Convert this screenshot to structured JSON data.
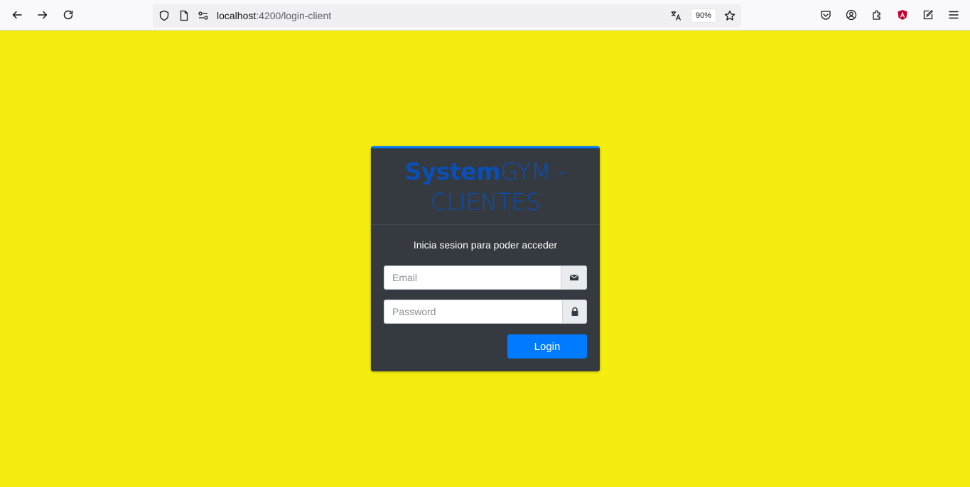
{
  "browser": {
    "url_host": "localhost",
    "url_rest": ":4200/login-client",
    "zoom": "90%"
  },
  "login": {
    "brand_bold": "System",
    "brand_light": "GYM - CLIENTES",
    "message": "Inicia sesion para poder acceder",
    "email_placeholder": "Email",
    "password_placeholder": "Password",
    "login_label": "Login"
  },
  "colors": {
    "page_background": "#f5ec10",
    "card_background": "#343a40",
    "brand": "#0a4fb5",
    "primary": "#007bff"
  },
  "icons": {
    "email_addon": "envelope-icon",
    "password_addon": "lock-icon"
  }
}
